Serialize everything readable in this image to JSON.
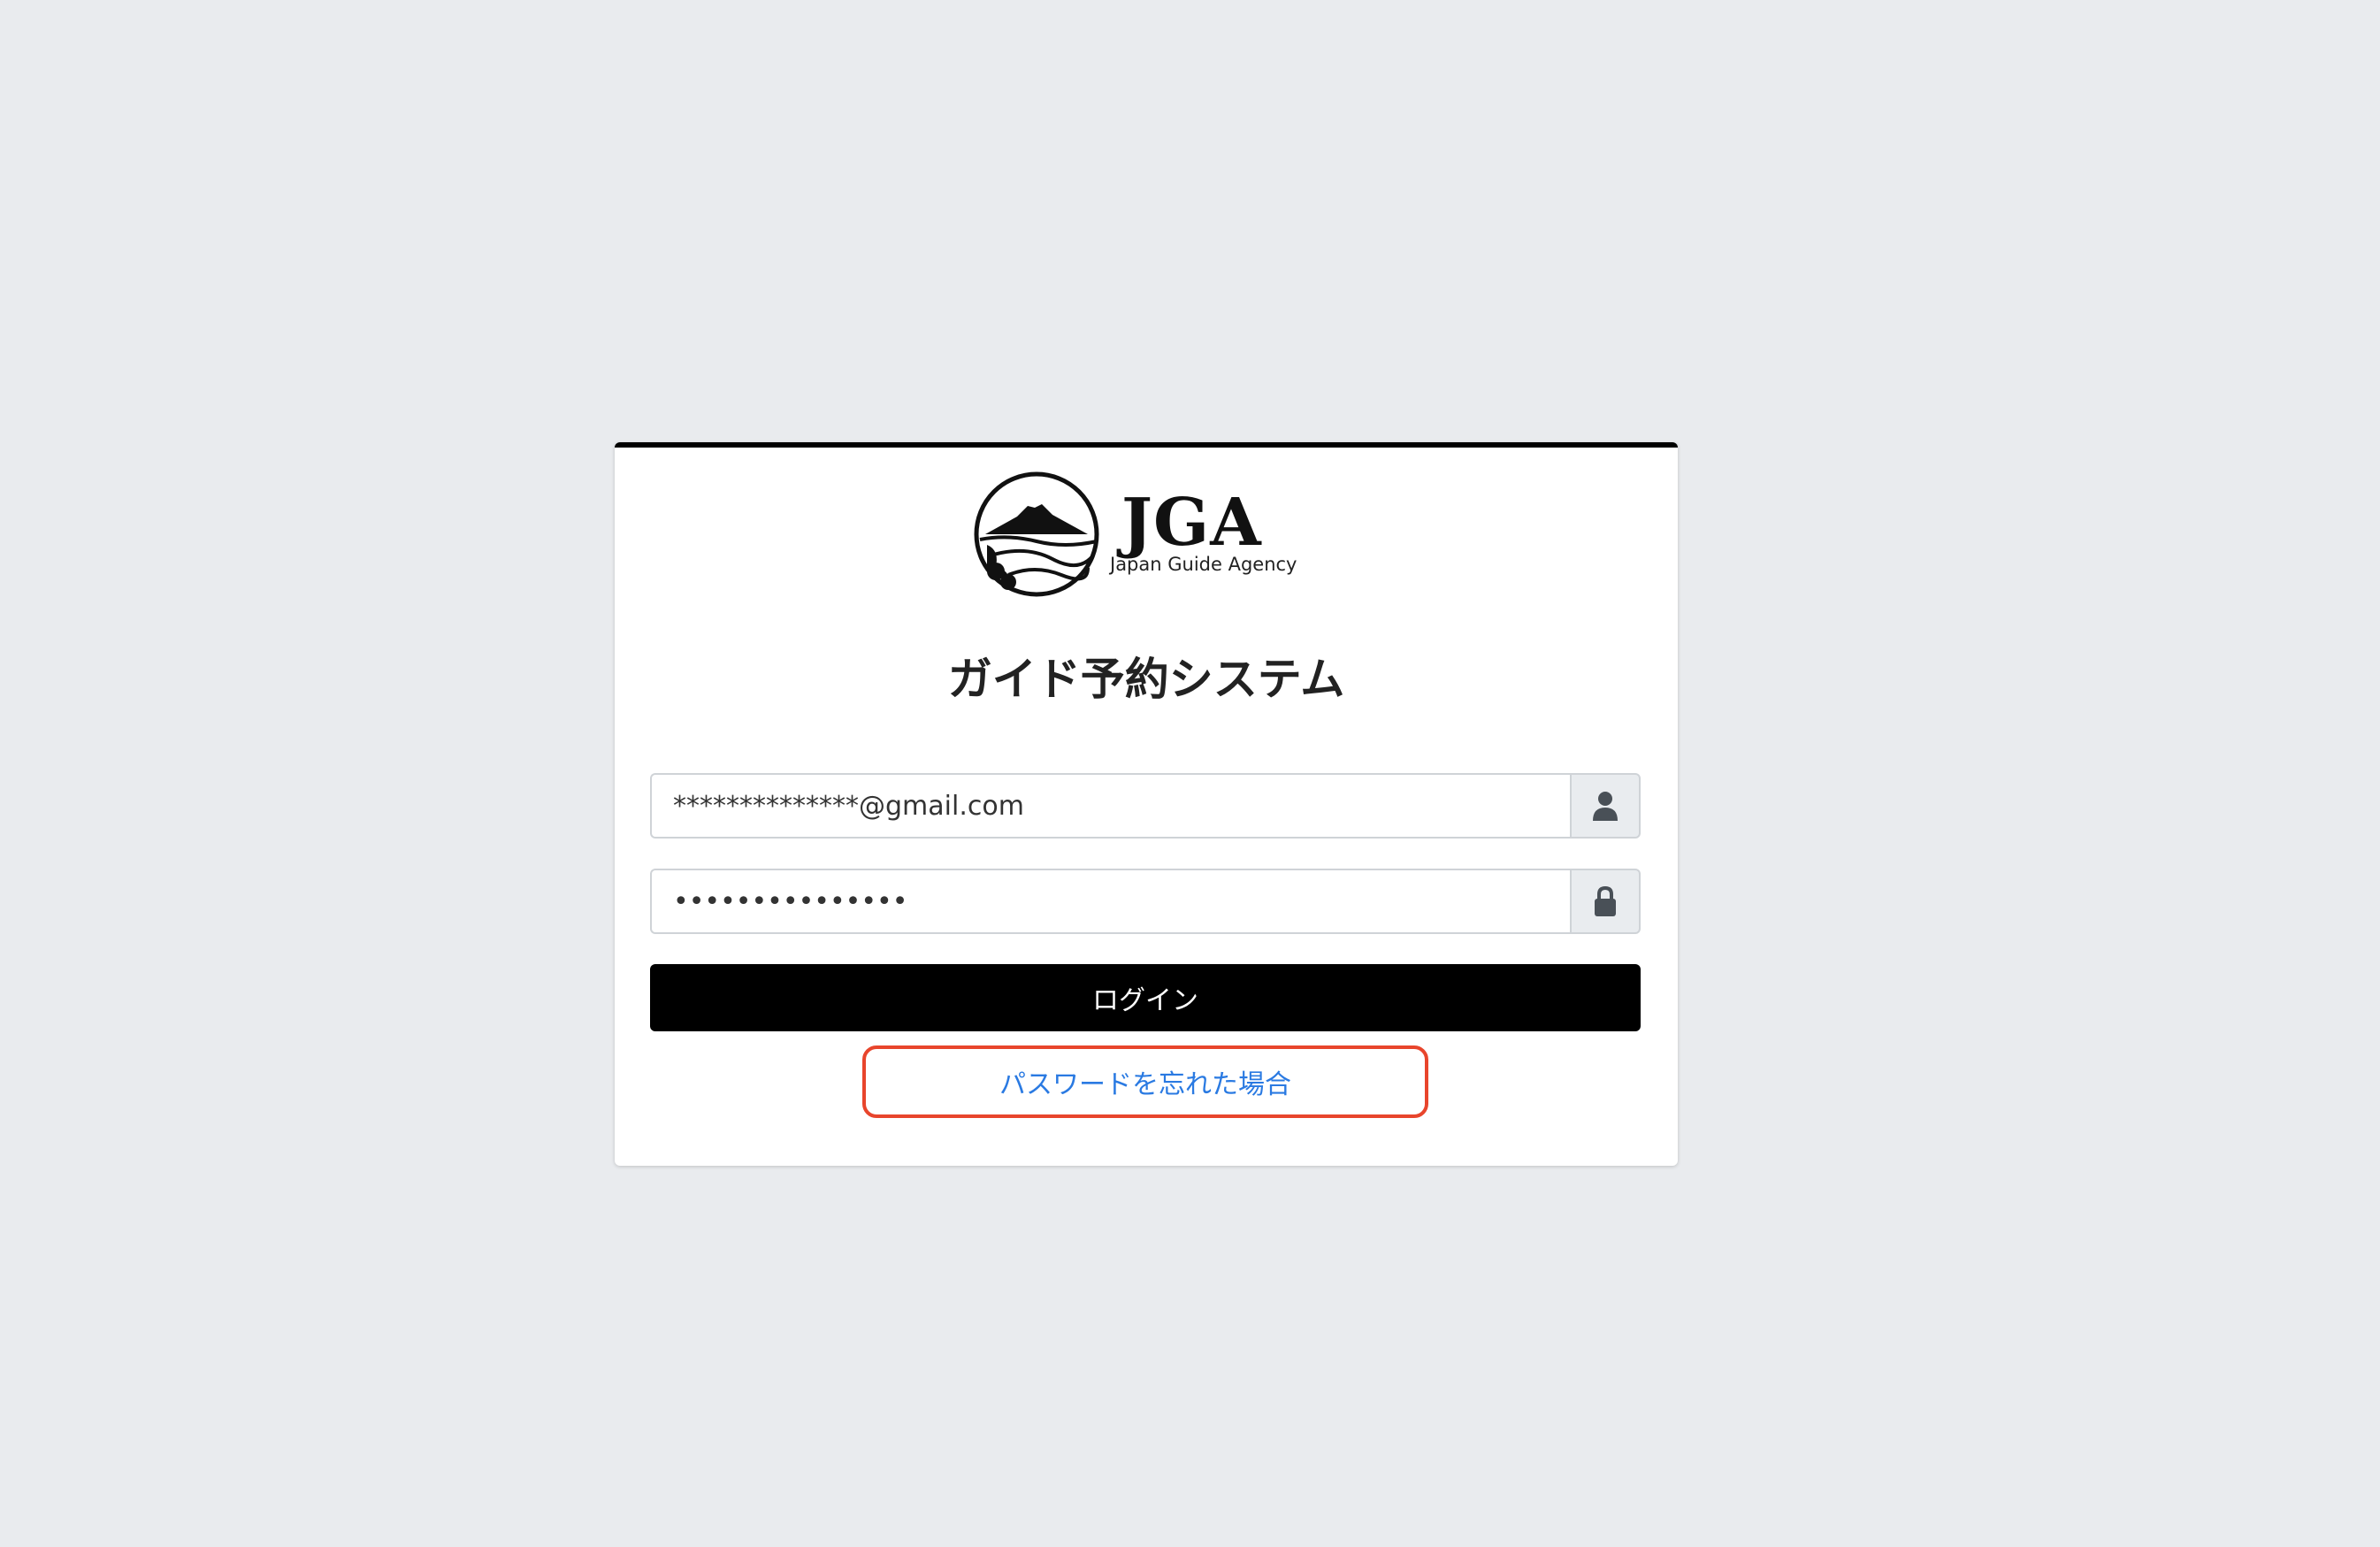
{
  "logo": {
    "mark": "JGA",
    "subtitle": "Japan Guide Agency"
  },
  "page_title": "ガイド予約システム",
  "form": {
    "email_value": "**************@gmail.com",
    "email_icon": "user-icon",
    "password_value": "•••••••••••••••",
    "password_icon": "lock-icon",
    "login_label": "ログイン",
    "forgot_label": "パスワードを忘れた場合"
  },
  "colors": {
    "background": "#e9ebee",
    "card": "#ffffff",
    "accent_bar": "#000000",
    "button": "#000000",
    "link": "#2a7ae2",
    "highlight": "#e8452c"
  }
}
